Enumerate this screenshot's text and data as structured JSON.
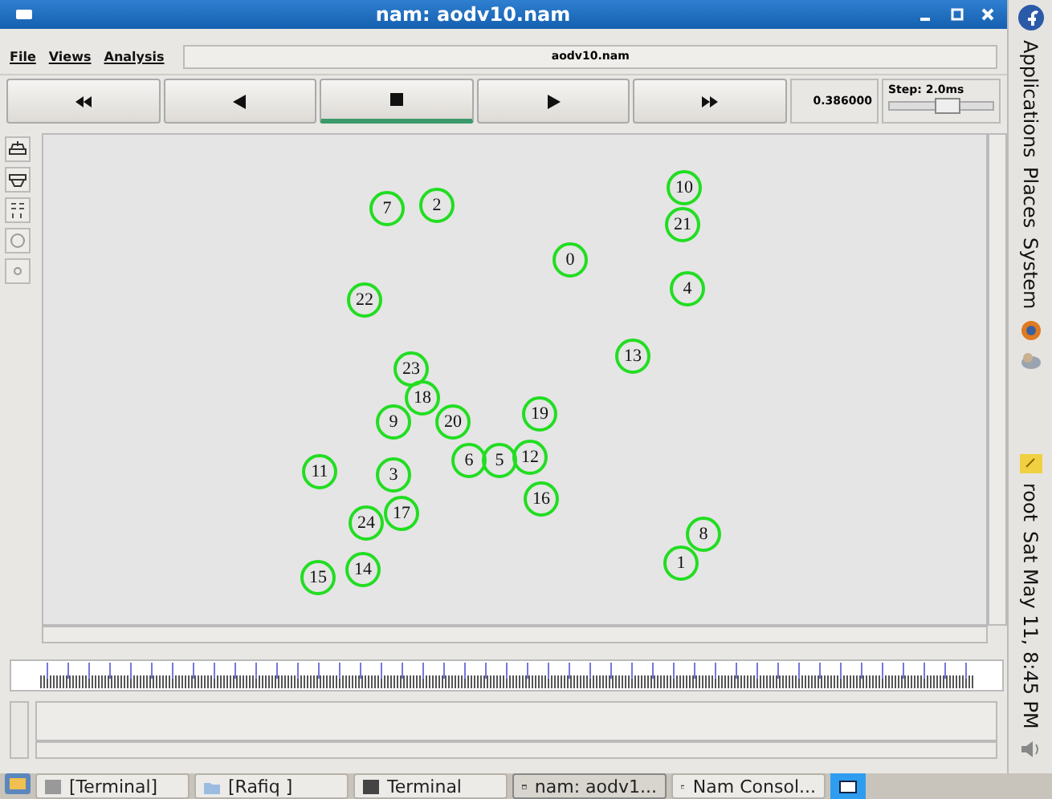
{
  "window": {
    "title": "nam: aodv10.nam"
  },
  "menu": [
    "File",
    "Views",
    "Analysis"
  ],
  "file_label": "aodv10.nam",
  "controls": [
    {
      "kind": "rewind",
      "selected": false
    },
    {
      "kind": "back",
      "selected": false
    },
    {
      "kind": "stop",
      "selected": true
    },
    {
      "kind": "play",
      "selected": false
    },
    {
      "kind": "forward",
      "selected": false
    }
  ],
  "time": "0.386000",
  "step": {
    "label": "Step: 2.0ms",
    "level": 0.55
  },
  "nodes": [
    "7",
    "2",
    "10",
    "21",
    "0",
    "4",
    "22",
    "13",
    "23",
    "18",
    "9",
    "20",
    "19",
    "11",
    "3",
    "6",
    "5",
    "12",
    "16",
    "24",
    "17",
    "8",
    "1",
    "15",
    "14"
  ],
  "panel": {
    "menus": [
      "Applications",
      "Places",
      "System"
    ],
    "user": "root",
    "clock": "Sat May 11,  8:45 PM"
  },
  "taskbar": [
    {
      "label": "[Terminal]",
      "selected": false
    },
    {
      "label": "[Rafiq ]",
      "selected": false
    },
    {
      "label": "Terminal",
      "selected": false
    },
    {
      "label": "nam: aodv1...",
      "selected": true
    },
    {
      "label": "Nam Consol...",
      "selected": false
    }
  ]
}
